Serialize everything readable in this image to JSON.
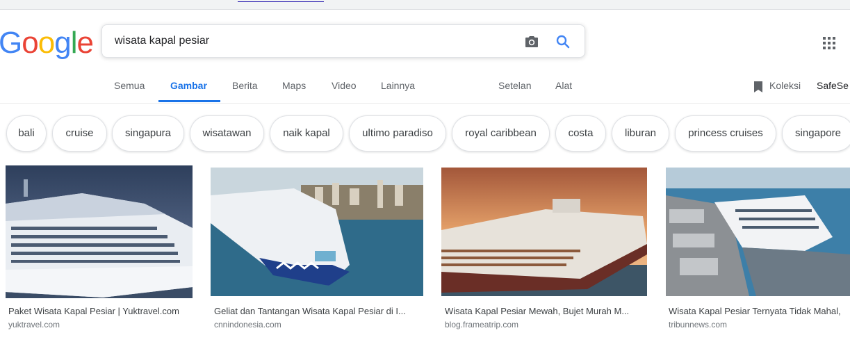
{
  "logo": {
    "letters": [
      "G",
      "o",
      "o",
      "g",
      "l",
      "e"
    ]
  },
  "search": {
    "query": "wisata kapal pesiar"
  },
  "tabs": [
    {
      "label": "Semua"
    },
    {
      "label": "Gambar"
    },
    {
      "label": "Berita"
    },
    {
      "label": "Maps"
    },
    {
      "label": "Video"
    },
    {
      "label": "Lainnya"
    }
  ],
  "tools": {
    "settings": "Setelan",
    "tools": "Alat"
  },
  "right_tools": {
    "koleksi": "Koleksi",
    "safesearch": "SafeSe"
  },
  "chips": [
    "bali",
    "cruise",
    "singapura",
    "wisatawan",
    "naik kapal",
    "ultimo paradiso",
    "royal caribbean",
    "costa",
    "liburan",
    "princess cruises",
    "singapore"
  ],
  "results": [
    {
      "title": "Paket Wisata Kapal Pesiar | Yuktravel.com",
      "source": "yuktravel.com"
    },
    {
      "title": "Geliat dan Tantangan Wisata Kapal Pesiar di I...",
      "source": "cnnindonesia.com"
    },
    {
      "title": "Wisata Kapal Pesiar Mewah, Bujet Murah M...",
      "source": "blog.frameatrip.com"
    },
    {
      "title": "Wisata Kapal Pesiar Ternyata Tidak Mahal,",
      "source": "tribunnews.com"
    }
  ],
  "colors": {
    "accent": "#1a73e8",
    "g_blue": "#4285f4",
    "g_red": "#ea4335",
    "g_yellow": "#fbbc05",
    "g_green": "#34a853"
  },
  "icons": {
    "camera": "camera-icon",
    "search": "search-icon",
    "apps": "apps-grid-icon",
    "koleksi": "bookmark-icon"
  }
}
